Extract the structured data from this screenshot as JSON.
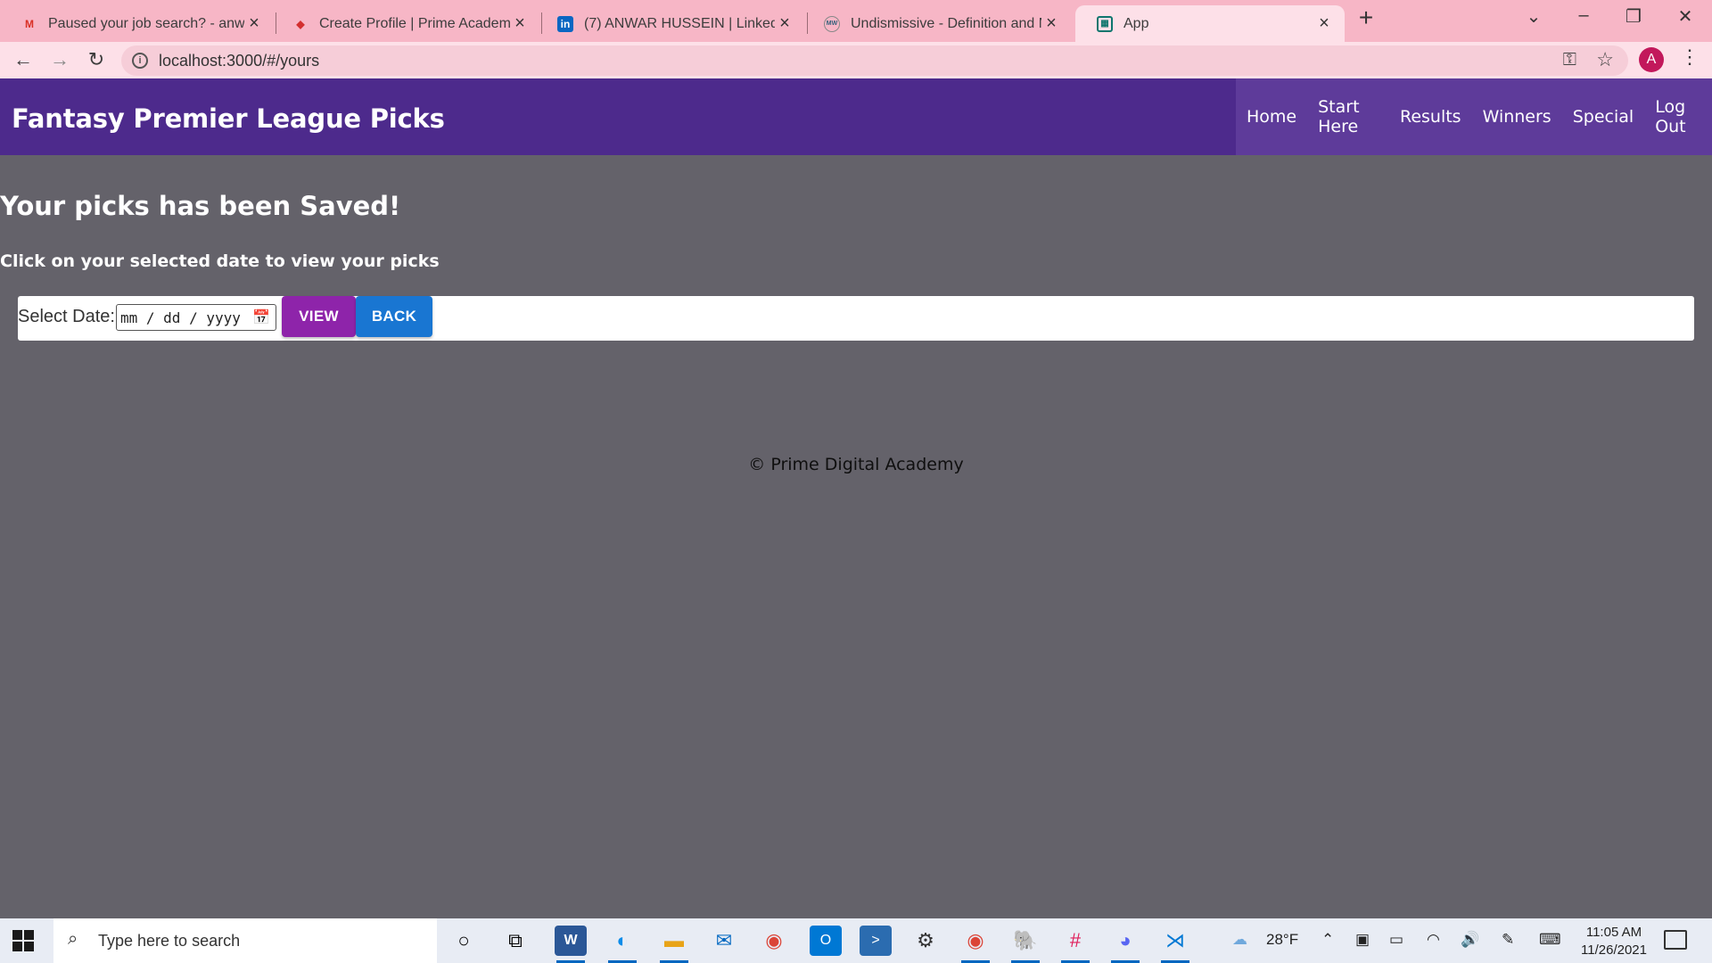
{
  "browser": {
    "tabs": [
      {
        "title": "Paused your job search? - anwar",
        "icon": "gmail-icon",
        "active": false
      },
      {
        "title": "Create Profile | Prime Academy",
        "icon": "prime-academy-icon",
        "active": false
      },
      {
        "title": "(7) ANWAR HUSSEIN | LinkedIn",
        "icon": "linkedin-icon",
        "active": false
      },
      {
        "title": "Undismissive - Definition and Mc",
        "icon": "merriam-webster-icon",
        "active": false
      },
      {
        "title": "App",
        "icon": "app-icon",
        "active": true
      }
    ],
    "url": "localhost:3000/#/yours",
    "profile_initial": "A"
  },
  "header": {
    "title": "Fantasy Premier League Picks",
    "nav": [
      "Home",
      "Start Here",
      "Results",
      "Winners",
      "Special",
      "Log Out"
    ]
  },
  "main": {
    "heading": "Your picks has been Saved!",
    "subheading": "Click on your selected date to view your picks",
    "picker": {
      "label": "Select Date:",
      "value": "mm / dd / yyyy",
      "view_label": "VIEW",
      "back_label": "BACK"
    }
  },
  "footer": {
    "text": "© Prime Digital Academy"
  },
  "taskbar": {
    "search_placeholder": "Type here to search",
    "weather": "28°F",
    "time": "11:05 AM",
    "date": "11/26/2021"
  },
  "colors": {
    "header_bg": "#4d2a8c",
    "nav_bg": "#5e3b9a",
    "page_bg": "#64626a",
    "view_button": "#8e24aa",
    "back_button": "#1976d2"
  }
}
